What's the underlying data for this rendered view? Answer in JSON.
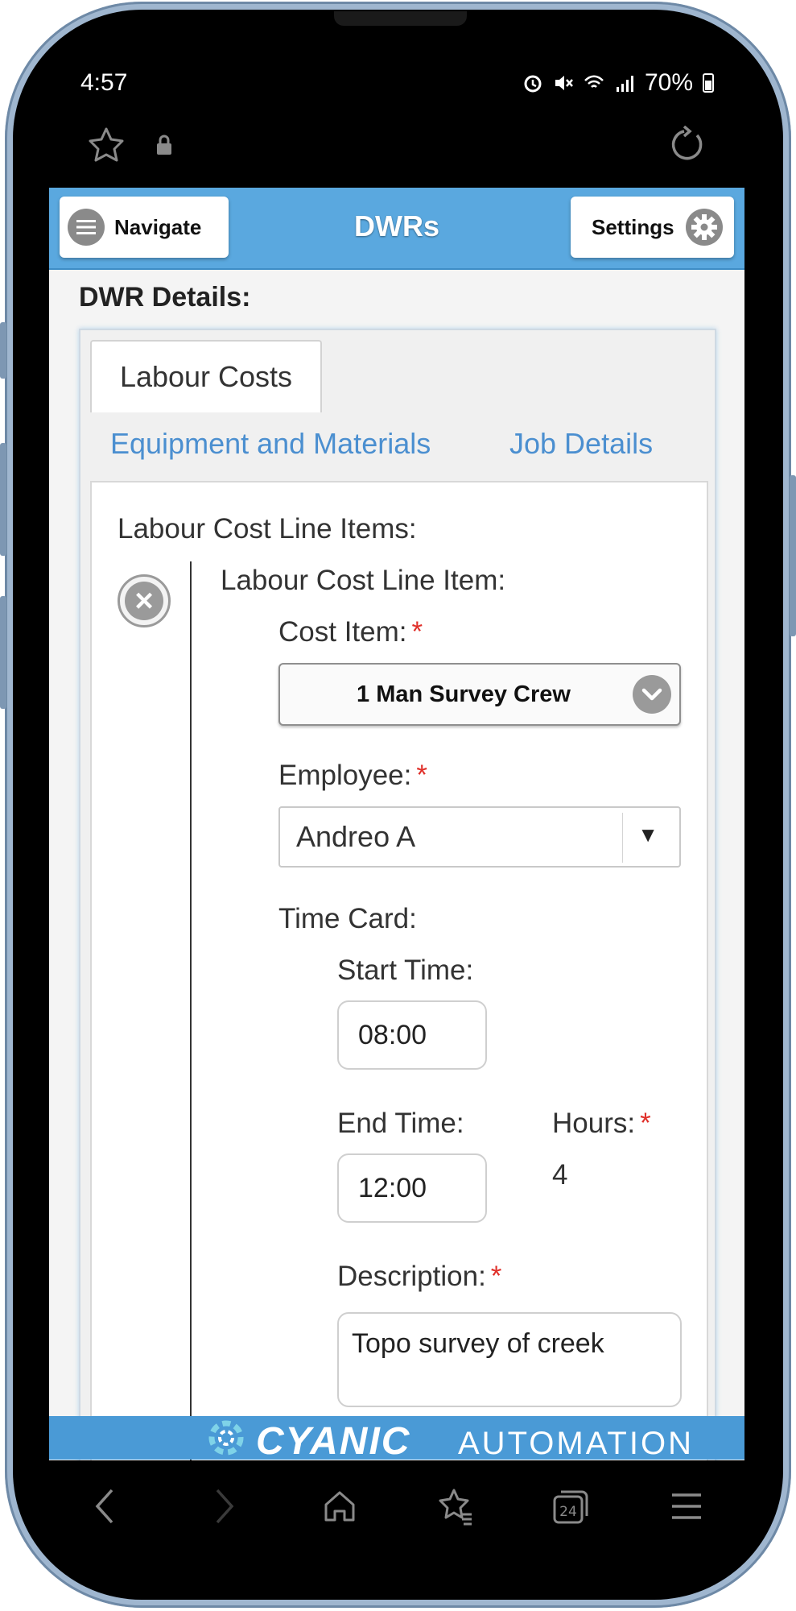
{
  "status_bar": {
    "time": "4:57",
    "battery": "70%",
    "icons": [
      "alarm-icon",
      "mute-icon",
      "wifi-icon",
      "signal-icon",
      "battery-icon"
    ]
  },
  "browser": {
    "icons": [
      "star-icon",
      "lock-icon",
      "reload-icon"
    ]
  },
  "header": {
    "navigate_label": "Navigate",
    "title": "DWRs",
    "settings_label": "Settings",
    "color": "#5aa8df"
  },
  "page": {
    "title": "DWR Details:"
  },
  "tabs": {
    "active": "Labour Costs",
    "links": [
      "Equipment and Materials",
      "Job Details"
    ]
  },
  "form": {
    "section_label": "Labour Cost Line Items:",
    "item_label": "Labour Cost Line Item:",
    "cost_item_label": "Cost Item:",
    "cost_item_value": "1 Man Survey Crew",
    "employee_label": "Employee:",
    "employee_value": "Andreo A",
    "time_card_label": "Time Card:",
    "start_time_label": "Start Time:",
    "start_time_value": "08:00",
    "end_time_label": "End Time:",
    "end_time_value": "12:00",
    "hours_label": "Hours:",
    "hours_value": "4",
    "description_label": "Description:",
    "description_value": "Topo survey of creek",
    "required_mark": "*"
  },
  "footer": {
    "brand_main": "CYANIC",
    "brand_sub": "AUTOMATION"
  },
  "nav_bar": {
    "icons": [
      "back-icon",
      "forward-icon",
      "home-icon",
      "bookmarks-icon",
      "tabs-icon",
      "menu-icon"
    ],
    "tabs_count": "24"
  }
}
